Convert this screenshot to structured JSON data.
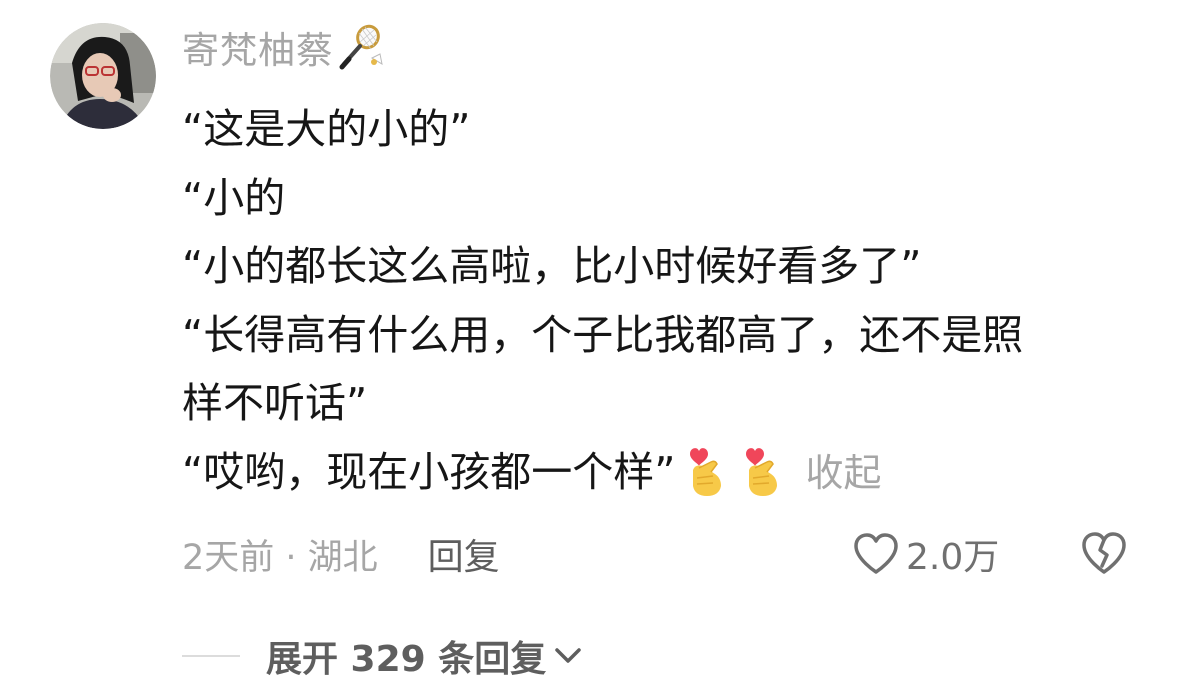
{
  "comment": {
    "username": "寄梵柚蔡",
    "username_badge_icon": "badminton-racket-icon",
    "avatar_icon": "user-avatar",
    "lines": [
      "“这是大的小的”",
      "“小的",
      "“小的都长这么高啦，比小时候好看多了”",
      "“长得高有什么用，个子比我都高了，还不是照",
      "样不听话”",
      "“哎哟，现在小孩都一个样”"
    ],
    "trailing_emojis": [
      "finger-heart-emoji",
      "finger-heart-emoji"
    ],
    "collapse_label": "收起",
    "time_location": "2天前 · 湖北",
    "reply_label": "回复",
    "like_count": "2.0万",
    "like_icon": "heart-outline-icon",
    "dislike_icon": "broken-heart-icon",
    "expand_replies_label": "展开 329 条回复",
    "expand_icon": "chevron-down-icon"
  },
  "colors": {
    "text_primary": "#161616",
    "text_secondary": "#a6a6a6",
    "text_action": "#5e5e5e",
    "background": "#ffffff"
  }
}
